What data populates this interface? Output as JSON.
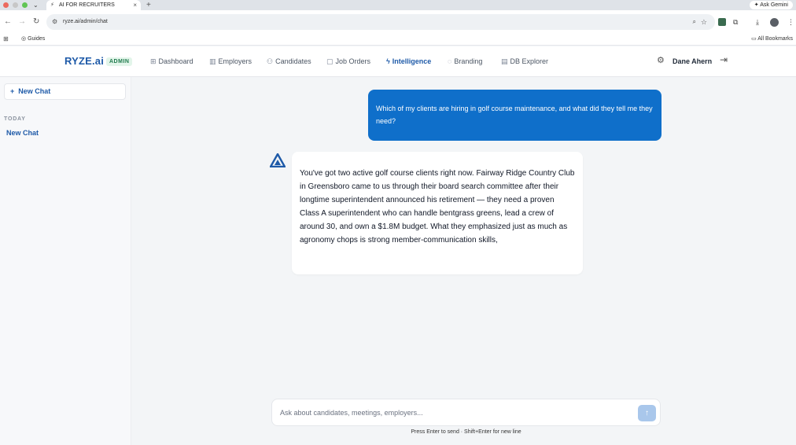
{
  "browser": {
    "tab_title": "AI FOR RECRUITERS",
    "url": "ryze.ai/admin/chat",
    "ask_gemini": "Ask Gemini",
    "bookmark_guides": "Guides",
    "all_bookmarks": "All Bookmarks"
  },
  "header": {
    "logo": "RYZE.ai",
    "badge": "ADMIN",
    "nav": [
      {
        "label": "Dashboard",
        "icon": "grid-icon"
      },
      {
        "label": "Employers",
        "icon": "building-icon"
      },
      {
        "label": "Candidates",
        "icon": "users-icon"
      },
      {
        "label": "Job Orders",
        "icon": "briefcase-icon"
      },
      {
        "label": "Intelligence",
        "icon": "lightning-icon"
      },
      {
        "label": "Branding",
        "icon": "palette-icon"
      },
      {
        "label": "DB Explorer",
        "icon": "database-icon"
      }
    ],
    "active_nav": "Intelligence",
    "user_name": "Dane Ahern"
  },
  "sidebar": {
    "new_chat_label": "New Chat",
    "section_label": "TODAY",
    "items": [
      {
        "label": "New Chat"
      }
    ]
  },
  "chat": {
    "messages": [
      {
        "role": "user",
        "text": "Which of my clients are hiring in golf course maintenance, and what did they tell me they need?"
      },
      {
        "role": "assistant",
        "text": "You've got two active golf course clients right now. Fairway Ridge Country Club in Greensboro came to us through their board search committee after their longtime superintendent announced his retirement — they need a proven Class A superintendent who can handle bentgrass greens, lead a crew of around 30, and own a $1.8M budget. What they emphasized just as much as agronomy chops is strong member-communication skills,"
      }
    ],
    "input_placeholder": "Ask about candidates, meetings, employers...",
    "input_value": "",
    "hint": "Press Enter to send · Shift+Enter for new line"
  },
  "colors": {
    "brand": "#1e5aa8",
    "user_bubble": "#0f6fca",
    "admin_badge_text": "#1e7a4c",
    "send_button": "#a9c7eb"
  }
}
